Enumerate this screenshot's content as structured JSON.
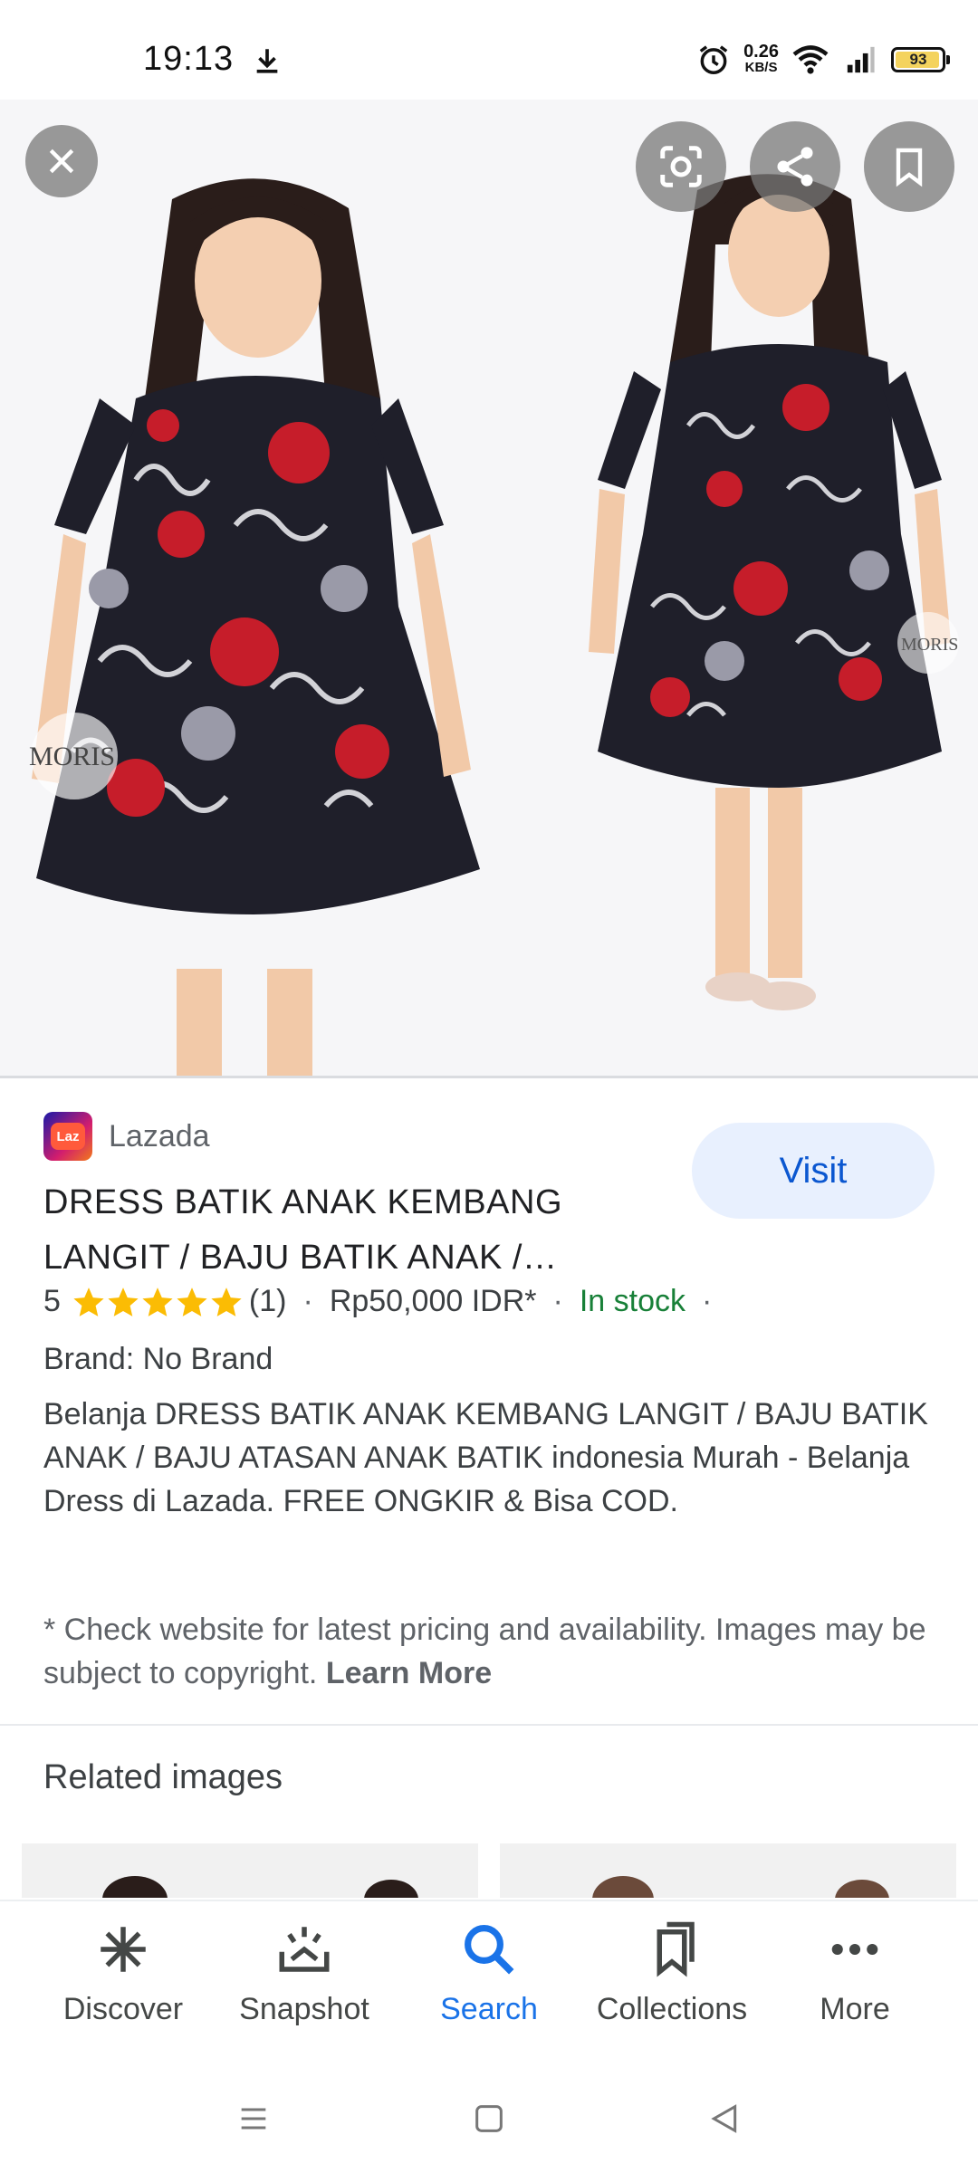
{
  "status_bar": {
    "time": "19:13",
    "net_speed_value": "0.26",
    "net_speed_unit": "KB/S",
    "battery_percent": "93"
  },
  "image_actions": {
    "close_icon": "close-icon",
    "lens_icon": "lens-icon",
    "share_icon": "share-icon",
    "bookmark_icon": "bookmark-icon"
  },
  "image": {
    "watermark_left": "MORIS",
    "watermark_right": "MORIS"
  },
  "result": {
    "source_logo_text": "Laz",
    "source_name": "Lazada",
    "visit_label": "Visit",
    "title": "DRESS BATIK ANAK KEMBANG LANGIT / BAJU BATIK ANAK /…",
    "rating": "5",
    "rating_stars": 5,
    "review_count": "(1)",
    "separator": "·",
    "price": "Rp50,000 IDR*",
    "availability": "In stock",
    "brand": "Brand: No Brand",
    "description": "Belanja DRESS BATIK ANAK KEMBANG LANGIT / BAJU BATIK ANAK / BAJU ATASAN ANAK BATIK indonesia Murah - Belanja Dress di Lazada. FREE ONGKIR & Bisa COD.",
    "disclaimer": "* Check website for latest pricing and availability. Images may be subject to copyright.",
    "learn_more": "Learn More"
  },
  "related": {
    "title": "Related images"
  },
  "bottom_nav": {
    "items": [
      {
        "label": "Discover",
        "icon": "asterisk-icon"
      },
      {
        "label": "Snapshot",
        "icon": "snapshot-icon"
      },
      {
        "label": "Search",
        "icon": "search-icon",
        "active": true
      },
      {
        "label": "Collections",
        "icon": "collections-icon"
      },
      {
        "label": "More",
        "icon": "more-icon"
      }
    ]
  },
  "colors": {
    "accent": "#1a73e8",
    "visit_bg": "#e8f0fe",
    "in_stock": "#188038",
    "star": "#fbbc04"
  }
}
